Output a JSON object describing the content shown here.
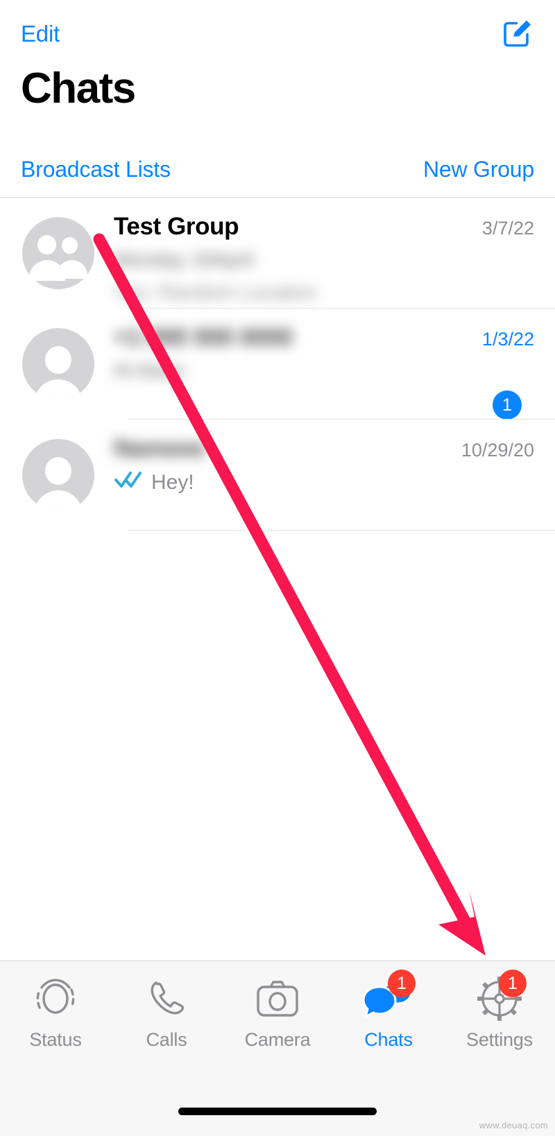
{
  "app": {
    "platform": "ios",
    "accent_color": "#0a84ff",
    "badge_color": "#ff3b30",
    "annotation_color": "#f8174f"
  },
  "navbar": {
    "edit_label": "Edit",
    "compose_icon": "compose-square-pencil-icon",
    "title": "Chats",
    "broadcast_label": "Broadcast Lists",
    "new_group_label": "New Group"
  },
  "chats": [
    {
      "avatar": "group-avatar-icon",
      "name": "Test Group",
      "name_blurred": false,
      "preview": "",
      "preview_blurred": true,
      "preview_line2": "",
      "date": "3/7/22",
      "date_unread": false,
      "unread_count": "",
      "ticks": false
    },
    {
      "avatar": "person-avatar-icon",
      "name": "",
      "name_blurred": true,
      "preview": "",
      "preview_blurred": true,
      "preview_line2": "",
      "date": "1/3/22",
      "date_unread": true,
      "unread_count": "1",
      "ticks": false
    },
    {
      "avatar": "person-avatar-icon",
      "name": "",
      "name_blurred": true,
      "preview": "Hey!",
      "preview_blurred": false,
      "preview_line2": "",
      "date": "10/29/20",
      "date_unread": false,
      "unread_count": "",
      "ticks": true
    }
  ],
  "tabbar": {
    "items": [
      {
        "label": "Status",
        "icon": "status-rings-icon",
        "active": false,
        "badge": ""
      },
      {
        "label": "Calls",
        "icon": "phone-handset-icon",
        "active": false,
        "badge": ""
      },
      {
        "label": "Camera",
        "icon": "camera-icon",
        "active": false,
        "badge": ""
      },
      {
        "label": "Chats",
        "icon": "chat-bubbles-icon",
        "active": true,
        "badge": "1"
      },
      {
        "label": "Settings",
        "icon": "gear-icon",
        "active": false,
        "badge": "1"
      }
    ]
  },
  "watermark": {
    "text": "www.deuaq.com"
  }
}
